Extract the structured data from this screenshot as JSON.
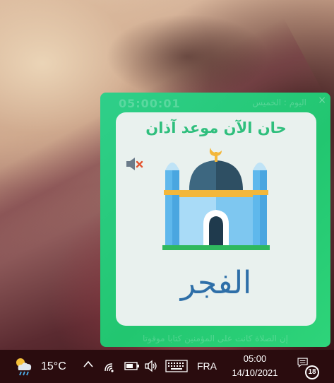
{
  "notification": {
    "countdown": "05:00:01",
    "day_label": "اليوم : الخميس",
    "close_glyph": "×",
    "headline": "حان الآن موعد آذان",
    "prayer_name": "الفجر",
    "footer_verse": "إن الصلاة كانت على المؤمنين كتابا موقوتا",
    "mute_icon": "speaker-muted-icon",
    "colors": {
      "panel": "#22c670",
      "headline": "#2fbf7d",
      "prayer_text": "#2e6fa8",
      "card": "#e9f1ee"
    }
  },
  "taskbar": {
    "weather_icon": "cloud-rain-sun-icon",
    "temperature": "15°C",
    "chevron_glyph": "^",
    "language": "FRA",
    "time": "05:00",
    "date": "14/10/2021",
    "notification_count": "18"
  }
}
